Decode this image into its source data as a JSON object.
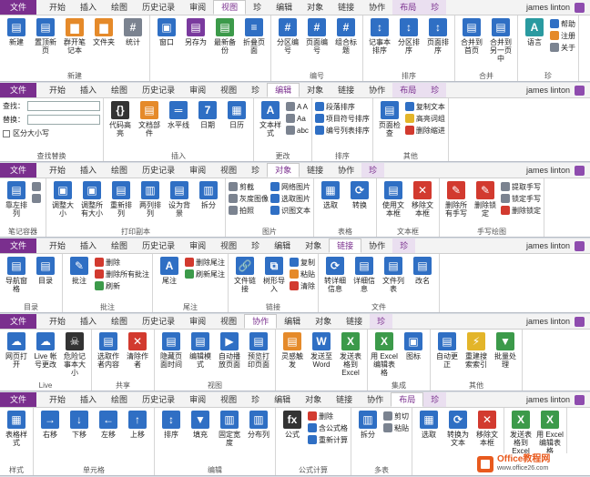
{
  "user": "james linton",
  "accent": "#7a2f8e",
  "bands": [
    {
      "tabs": [
        "文件",
        "开始",
        "插入",
        "绘图",
        "历史记录",
        "审阅",
        "视图",
        "珍",
        "编辑",
        "对象",
        "链接",
        "协作",
        "布局",
        "珍"
      ],
      "active": 6,
      "ctx_start": 12,
      "groups": [
        {
          "label": "新建",
          "big": [
            {
              "t": "新建",
              "c": "c-blue",
              "g": "▤"
            },
            {
              "t": "置顶新页",
              "c": "c-blue",
              "g": "▤"
            },
            {
              "t": "群开笔记本",
              "c": "c-orange",
              "g": "▆"
            },
            {
              "t": "文件夹",
              "c": "c-orange",
              "g": "▆"
            },
            {
              "t": "统计",
              "c": "c-gray",
              "g": "#"
            }
          ]
        },
        {
          "label": "",
          "big": [
            {
              "t": "窗口",
              "c": "c-blue",
              "g": "▣"
            },
            {
              "t": "另存为",
              "c": "c-purple",
              "g": "▤"
            },
            {
              "t": "最新备份",
              "c": "c-green",
              "g": "▤"
            },
            {
              "t": "折叠页面",
              "c": "c-blue",
              "g": "≡"
            }
          ]
        },
        {
          "label": "编号",
          "big": [
            {
              "t": "分区编号",
              "c": "c-blue",
              "g": "#"
            },
            {
              "t": "页面编号",
              "c": "c-blue",
              "g": "#"
            },
            {
              "t": "组合标题",
              "c": "c-blue",
              "g": "#"
            }
          ]
        },
        {
          "label": "排序",
          "big": [
            {
              "t": "记事本排序",
              "c": "c-blue",
              "g": "↕"
            },
            {
              "t": "分区排序",
              "c": "c-blue",
              "g": "↕"
            },
            {
              "t": "页面排序",
              "c": "c-blue",
              "g": "↕"
            }
          ]
        },
        {
          "label": "合并",
          "big": [
            {
              "t": "合并到首页",
              "c": "c-blue",
              "g": "▤"
            },
            {
              "t": "合并到另一页中",
              "c": "c-blue",
              "g": "▤"
            }
          ]
        },
        {
          "label": "珍",
          "big": [
            {
              "t": "语言",
              "c": "c-teal",
              "g": "A"
            }
          ],
          "small": [
            {
              "t": "帮助",
              "c": "c-blue"
            },
            {
              "t": "注册",
              "c": "c-orange"
            },
            {
              "t": "关于",
              "c": "c-gray"
            }
          ]
        }
      ]
    },
    {
      "tabs": [
        "文件",
        "开始",
        "插入",
        "绘图",
        "历史记录",
        "审阅",
        "视图",
        "珍",
        "编辑",
        "对象",
        "链接",
        "协作",
        "布局",
        "珍"
      ],
      "active": 8,
      "ctx_start": 12,
      "find": {
        "find_label": "查找：",
        "replace_label": "替换：",
        "case_label": "区分大小写",
        "group": "查找替换"
      },
      "groups": [
        {
          "label": "插入",
          "big": [
            {
              "t": "代码高亮",
              "c": "c-dark",
              "g": "{}"
            },
            {
              "t": "文档部件",
              "c": "c-orange",
              "g": "▤"
            },
            {
              "t": "水平线",
              "c": "c-blue",
              "g": "═"
            },
            {
              "t": "日期",
              "c": "c-blue",
              "g": "7"
            },
            {
              "t": "日历",
              "c": "c-blue",
              "g": "▦"
            }
          ]
        },
        {
          "label": "更改",
          "big": [
            {
              "t": "文本样式",
              "c": "c-blue",
              "g": "A"
            }
          ],
          "small": [
            {
              "t": "A  A",
              "c": "c-gray"
            },
            {
              "t": "Aa",
              "c": "c-gray"
            },
            {
              "t": "abc",
              "c": "c-gray"
            }
          ]
        },
        {
          "label": "排序",
          "small": [
            {
              "t": "段落排序",
              "c": "c-blue"
            },
            {
              "t": "项目符号排序",
              "c": "c-blue"
            },
            {
              "t": "编号列表排序",
              "c": "c-blue"
            }
          ]
        },
        {
          "label": "其他",
          "big": [
            {
              "t": "页面检查",
              "c": "c-blue",
              "g": "▤"
            }
          ],
          "small": [
            {
              "t": "复制文本",
              "c": "c-blue"
            },
            {
              "t": "高亮词组",
              "c": "c-yellow"
            },
            {
              "t": "删除缩进",
              "c": "c-red"
            }
          ]
        }
      ]
    },
    {
      "tabs": [
        "文件",
        "开始",
        "插入",
        "绘图",
        "历史记录",
        "审阅",
        "视图",
        "珍",
        "对象",
        "链接",
        "协作",
        "珍"
      ],
      "active": 8,
      "ctx_start": 11,
      "groups": [
        {
          "label": "笔记容器",
          "big": [
            {
              "t": "靠左排列",
              "c": "c-blue",
              "g": "▤"
            }
          ],
          "small": [
            {
              "t": "",
              "c": "c-gray"
            },
            {
              "t": "",
              "c": "c-gray"
            }
          ]
        },
        {
          "label": "打印副本",
          "big": [
            {
              "t": "调整大小",
              "c": "c-blue",
              "g": "▣"
            },
            {
              "t": "调整所有大小",
              "c": "c-blue",
              "g": "▣"
            },
            {
              "t": "重新排列",
              "c": "c-blue",
              "g": "▤"
            },
            {
              "t": "两列排列",
              "c": "c-blue",
              "g": "▥"
            },
            {
              "t": "设为背景",
              "c": "c-blue",
              "g": "▤"
            },
            {
              "t": "拆分",
              "c": "c-blue",
              "g": "▥"
            }
          ]
        },
        {
          "label": "图片",
          "small": [
            {
              "t": "剪截",
              "c": "c-gray"
            },
            {
              "t": "灰度图像",
              "c": "c-gray"
            },
            {
              "t": "拍照",
              "c": "c-gray"
            }
          ],
          "small2": [
            {
              "t": "网络图片",
              "c": "c-blue"
            },
            {
              "t": "选取图片",
              "c": "c-blue"
            },
            {
              "t": "识图文本",
              "c": "c-blue"
            }
          ]
        },
        {
          "label": "表格",
          "big": [
            {
              "t": "选取",
              "c": "c-blue",
              "g": "▦"
            },
            {
              "t": "转换",
              "c": "c-blue",
              "g": "⟳"
            }
          ]
        },
        {
          "label": "文本框",
          "big": [
            {
              "t": "使用文本框",
              "c": "c-blue",
              "g": "▤"
            },
            {
              "t": "移除文本框",
              "c": "c-red",
              "g": "✕"
            }
          ]
        },
        {
          "label": "手写绘图",
          "big": [
            {
              "t": "删除所有手写",
              "c": "c-red",
              "g": "✎"
            },
            {
              "t": "删除锁定",
              "c": "c-red",
              "g": "✎"
            }
          ],
          "small": [
            {
              "t": "提取手写",
              "c": "c-gray"
            },
            {
              "t": "锁定手写",
              "c": "c-gray"
            },
            {
              "t": "删除锁定",
              "c": "c-red"
            }
          ]
        }
      ]
    },
    {
      "tabs": [
        "文件",
        "开始",
        "插入",
        "绘图",
        "历史记录",
        "审阅",
        "视图",
        "珍",
        "编辑",
        "对象",
        "链接",
        "协作",
        "珍"
      ],
      "active": 10,
      "ctx_start": 12,
      "groups": [
        {
          "label": "目录",
          "big": [
            {
              "t": "导航窗格",
              "c": "c-blue",
              "g": "▤"
            },
            {
              "t": "目录",
              "c": "c-blue",
              "g": "▤"
            }
          ]
        },
        {
          "label": "批注",
          "big": [
            {
              "t": "批注",
              "c": "c-blue",
              "g": "✎"
            }
          ],
          "small": [
            {
              "t": "删除",
              "c": "c-red"
            },
            {
              "t": "删除所有批注",
              "c": "c-red"
            },
            {
              "t": "刷新",
              "c": "c-green"
            }
          ]
        },
        {
          "label": "尾注",
          "big": [
            {
              "t": "尾注",
              "c": "c-blue",
              "g": "A"
            }
          ],
          "small": [
            {
              "t": "删除尾注",
              "c": "c-red"
            },
            {
              "t": "刷新尾注",
              "c": "c-green"
            }
          ]
        },
        {
          "label": "链接",
          "big": [
            {
              "t": "文件链接",
              "c": "c-blue",
              "g": "🔗"
            },
            {
              "t": "树形导入",
              "c": "c-blue",
              "g": "⧉"
            }
          ],
          "small": [
            {
              "t": "复制",
              "c": "c-blue"
            },
            {
              "t": "粘贴",
              "c": "c-orange"
            },
            {
              "t": "清除",
              "c": "c-red"
            }
          ]
        },
        {
          "label": "文件",
          "big": [
            {
              "t": "转详细信息",
              "c": "c-blue",
              "g": "⟳"
            },
            {
              "t": "详细信息",
              "c": "c-blue",
              "g": "▤"
            },
            {
              "t": "文件列表",
              "c": "c-blue",
              "g": "▤"
            },
            {
              "t": "改名",
              "c": "c-blue",
              "g": "▤"
            }
          ]
        }
      ]
    },
    {
      "tabs": [
        "文件",
        "开始",
        "插入",
        "绘图",
        "历史记录",
        "审阅",
        "视图",
        "协作",
        "编辑",
        "对象",
        "链接",
        "珍"
      ],
      "active": 7,
      "ctx_start": 11,
      "groups": [
        {
          "label": "Live",
          "big": [
            {
              "t": "网页打开",
              "c": "c-blue",
              "g": "☁"
            },
            {
              "t": "Live 帐号更改",
              "c": "c-blue",
              "g": "☁"
            },
            {
              "t": "危险记事本大小",
              "c": "c-dark",
              "g": "☠"
            }
          ]
        },
        {
          "label": "共享",
          "big": [
            {
              "t": "选取作者内容",
              "c": "c-blue",
              "g": "▤"
            },
            {
              "t": "清除作者",
              "c": "c-red",
              "g": "✕"
            }
          ]
        },
        {
          "label": "视图",
          "big": [
            {
              "t": "隐藏页面时间",
              "c": "c-blue",
              "g": "▤"
            },
            {
              "t": "编辑模式",
              "c": "c-blue",
              "g": "▤"
            },
            {
              "t": "自动播放页面",
              "c": "c-blue",
              "g": "▶"
            },
            {
              "t": "预览打印页面",
              "c": "c-blue",
              "g": "▤"
            }
          ]
        },
        {
          "label": "",
          "big": [
            {
              "t": "灵感触发",
              "c": "c-orange",
              "g": "▤"
            },
            {
              "t": "发送至 Word",
              "c": "c-blue",
              "g": "W"
            },
            {
              "t": "发送表格到 Excel",
              "c": "c-green",
              "g": "X"
            }
          ]
        },
        {
          "label": "集成",
          "big": [
            {
              "t": "用 Excel 编辑表格",
              "c": "c-green",
              "g": "X"
            },
            {
              "t": "图标",
              "c": "c-blue",
              "g": "▣"
            }
          ]
        },
        {
          "label": "其他",
          "big": [
            {
              "t": "自动更正",
              "c": "c-blue",
              "g": "▤"
            },
            {
              "t": "重建搜索索引",
              "c": "c-yellow",
              "g": "⚡"
            },
            {
              "t": "批量处理",
              "c": "c-green",
              "g": "▼"
            }
          ]
        }
      ]
    },
    {
      "tabs": [
        "文件",
        "开始",
        "插入",
        "绘图",
        "历史记录",
        "审阅",
        "视图",
        "珍",
        "编辑",
        "对象",
        "链接",
        "协作",
        "布局",
        "珍"
      ],
      "active": 12,
      "ctx_start": 12,
      "groups": [
        {
          "label": "样式",
          "big": [
            {
              "t": "表格样式",
              "c": "c-blue",
              "g": "▦"
            }
          ]
        },
        {
          "label": "单元格",
          "big": [
            {
              "t": "右移",
              "c": "c-blue",
              "g": "→"
            },
            {
              "t": "下移",
              "c": "c-blue",
              "g": "↓"
            },
            {
              "t": "左移",
              "c": "c-blue",
              "g": "←"
            },
            {
              "t": "上移",
              "c": "c-blue",
              "g": "↑"
            }
          ]
        },
        {
          "label": "编辑",
          "big": [
            {
              "t": "排序",
              "c": "c-blue",
              "g": "↕"
            },
            {
              "t": "填充",
              "c": "c-blue",
              "g": "▼"
            },
            {
              "t": "固定宽度",
              "c": "c-blue",
              "g": "▥"
            },
            {
              "t": "分布列",
              "c": "c-blue",
              "g": "▥"
            }
          ]
        },
        {
          "label": "公式计算",
          "big": [
            {
              "t": "公式",
              "c": "c-dark",
              "g": "fx"
            }
          ],
          "small": [
            {
              "t": "删除",
              "c": "c-red"
            },
            {
              "t": "含公式格",
              "c": "c-blue"
            },
            {
              "t": "重新计算",
              "c": "c-blue"
            }
          ]
        },
        {
          "label": "多表",
          "big": [
            {
              "t": "拆分",
              "c": "c-blue",
              "g": "▥"
            }
          ],
          "small": [
            {
              "t": "剪切",
              "c": "c-gray"
            },
            {
              "t": "粘贴",
              "c": "c-gray"
            }
          ]
        },
        {
          "label": "",
          "big": [
            {
              "t": "选取",
              "c": "c-blue",
              "g": "▦"
            },
            {
              "t": "转换为文本",
              "c": "c-blue",
              "g": "⟳"
            },
            {
              "t": "移除文本框",
              "c": "c-red",
              "g": "✕"
            }
          ]
        },
        {
          "label": "其他",
          "big": [
            {
              "t": "发送表格到 Excel",
              "c": "c-green",
              "g": "X"
            },
            {
              "t": "用 Excel 编辑表格",
              "c": "c-green",
              "g": "X"
            }
          ]
        }
      ]
    }
  ],
  "watermark": {
    "title": "Office教程网",
    "url": "www.office26.com"
  }
}
